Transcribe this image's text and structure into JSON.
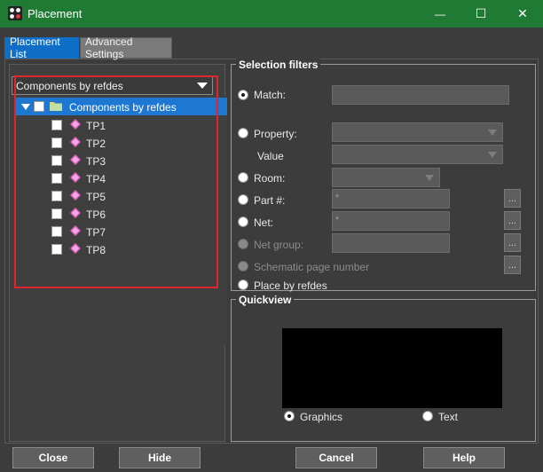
{
  "window": {
    "title": "Placement",
    "minimize_glyph": "—",
    "maximize_glyph": "☐",
    "close_glyph": "✕"
  },
  "tabs": [
    {
      "label": "Placement List",
      "active": true
    },
    {
      "label": "Advanced Settings",
      "active": false
    }
  ],
  "tree": {
    "dropdown_value": "Components by refdes",
    "root": {
      "label": "Components by refdes",
      "selected": true,
      "expanded": true
    },
    "items": [
      {
        "label": "TP1"
      },
      {
        "label": "TP2"
      },
      {
        "label": "TP3"
      },
      {
        "label": "TP4"
      },
      {
        "label": "TP5"
      },
      {
        "label": "TP6"
      },
      {
        "label": "TP7"
      },
      {
        "label": "TP8"
      }
    ]
  },
  "filters": {
    "title": "Selection filters",
    "match_label": "Match:",
    "property_label": "Property:",
    "value_label": "Value",
    "room_label": "Room:",
    "part_label": "Part #:",
    "part_value": "*",
    "net_label": "Net:",
    "net_value": "*",
    "netgroup_label": "Net group:",
    "schematic_label": "Schematic page number",
    "refdes_label": "Place by refdes",
    "ellipsis": "...",
    "selected_option": "Match"
  },
  "quickview": {
    "title": "Quickview",
    "graphics_label": "Graphics",
    "text_label": "Text",
    "selected_mode": "Graphics"
  },
  "buttons": {
    "close": "Close",
    "hide": "Hide",
    "cancel": "Cancel",
    "help": "Help"
  },
  "colors": {
    "titlebar": "#1f7a33",
    "active_tab": "#0f6ec6",
    "selection": "#1e78d2",
    "highlight_box": "#e0262c",
    "background": "#3c3c3c"
  },
  "icons": {
    "app": "placement-app-icon",
    "folder": "folder-icon",
    "part": "component-icon"
  }
}
